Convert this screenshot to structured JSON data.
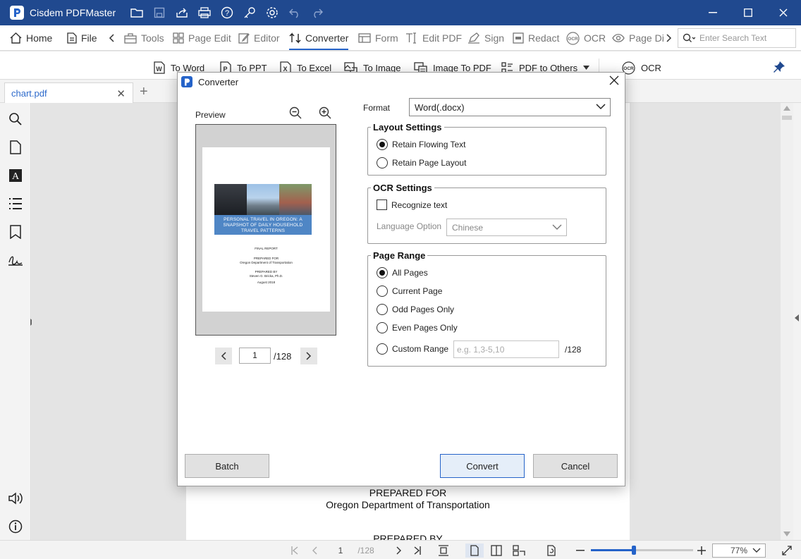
{
  "app": {
    "title": "Cisdem PDFMaster"
  },
  "menu": {
    "home": "Home",
    "file": "File",
    "tools": "Tools",
    "page_edit": "Page Edit",
    "editor": "Editor",
    "converter": "Converter",
    "form": "Form",
    "edit_pdf": "Edit PDF",
    "sign": "Sign",
    "redact": "Redact",
    "ocr": "OCR",
    "page_display": "Page Di"
  },
  "search": {
    "placeholder": "Enter Search Text"
  },
  "converter_toolbar": {
    "to_word": "To Word",
    "to_ppt": "To PPT",
    "to_excel": "To Excel",
    "to_image": "To Image",
    "image_to_pdf": "Image To PDF",
    "pdf_to_others": "PDF to Others",
    "ocr": "OCR"
  },
  "document_tab": {
    "name": "chart.pdf"
  },
  "page_text": {
    "prepared_for": "PREPARED FOR",
    "organization": "Oregon Department of Transportation",
    "prepared_by": "PREPARED BY"
  },
  "status": {
    "page": "1",
    "total": "/128",
    "zoom": "77%",
    "zoom_level": 0.42
  },
  "dialog": {
    "title": "Converter",
    "preview_label": "Preview",
    "cover": {
      "title": "PERSONAL TRAVEL IN OREGON: A SNAPSHOT OF DAILY HOUSEHOLD TRAVEL PATTERNS",
      "final_report": "FINAL REPORT",
      "prepared_for": "PREPARED FOR",
      "organization": "Oregon Department of Transportation",
      "prepared_by": "PREPARED BY",
      "author": "Steven G. Bricka, Ph.D.",
      "date": "August 2018"
    },
    "page_current": "1",
    "page_total": "/128",
    "format_label": "Format",
    "format_value": "Word(.docx)",
    "layout": {
      "title": "Layout Settings",
      "retain_flowing": "Retain Flowing Text",
      "retain_layout": "Retain Page Layout",
      "selected": "retain_flowing"
    },
    "ocr": {
      "title": "OCR Settings",
      "recognize": "Recognize text",
      "recognize_checked": false,
      "language_label": "Language Option",
      "language_value": "Chinese"
    },
    "range": {
      "title": "Page Range",
      "all": "All Pages",
      "current": "Current Page",
      "odd": "Odd Pages Only",
      "even": "Even Pages Only",
      "custom": "Custom Range",
      "custom_placeholder": "e.g. 1,3-5,10",
      "custom_total": "/128",
      "selected": "all"
    },
    "buttons": {
      "batch": "Batch",
      "convert": "Convert",
      "cancel": "Cancel"
    }
  },
  "colors": {
    "titlebar": "#20498f",
    "accent": "#2563c9"
  }
}
